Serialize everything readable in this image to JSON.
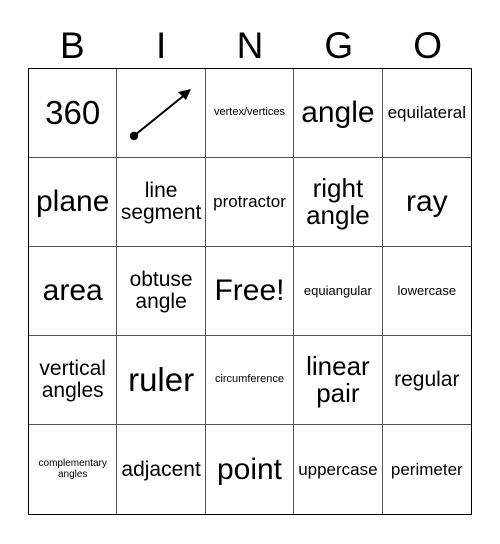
{
  "card": {
    "title_letters": [
      "B",
      "I",
      "N",
      "G",
      "O"
    ],
    "background_color": "#ffffff",
    "text_color": "#000000",
    "grid_border_color": "#000000",
    "cell_border_color": "#555555",
    "rows": 5,
    "columns": 5
  },
  "cells": [
    {
      "text": "360",
      "size": "fs-xxl",
      "type": "text"
    },
    {
      "text": "",
      "size": "fs-md",
      "type": "figure",
      "figure": "ray-diagram"
    },
    {
      "text": "vertex/vertices",
      "size": "fs-xxs",
      "type": "text"
    },
    {
      "text": "angle",
      "size": "fs-xl",
      "type": "text"
    },
    {
      "text": "equilateral",
      "size": "fs-sm",
      "type": "text"
    },
    {
      "text": "plane",
      "size": "fs-xl",
      "type": "text"
    },
    {
      "text": "line segment",
      "size": "fs-md",
      "type": "text"
    },
    {
      "text": "protractor",
      "size": "fs-sm",
      "type": "text"
    },
    {
      "text": "right angle",
      "size": "fs-lg",
      "type": "text"
    },
    {
      "text": "ray",
      "size": "fs-xl",
      "type": "text"
    },
    {
      "text": "area",
      "size": "fs-xl",
      "type": "text"
    },
    {
      "text": "obtuse angle",
      "size": "fs-md",
      "type": "text"
    },
    {
      "text": "Free!",
      "size": "fs-xl",
      "type": "text"
    },
    {
      "text": "equiangular",
      "size": "fs-xs",
      "type": "text"
    },
    {
      "text": "lowercase",
      "size": "fs-xs",
      "type": "text"
    },
    {
      "text": "vertical angles",
      "size": "fs-md",
      "type": "text"
    },
    {
      "text": "ruler",
      "size": "fs-xxl",
      "type": "text"
    },
    {
      "text": "circumference",
      "size": "fs-xxs",
      "type": "text"
    },
    {
      "text": "linear pair",
      "size": "fs-lg",
      "type": "text"
    },
    {
      "text": "regular",
      "size": "fs-md",
      "type": "text"
    },
    {
      "text": "complementary angles",
      "size": "fs-tiny",
      "type": "text"
    },
    {
      "text": "adjacent",
      "size": "fs-md",
      "type": "text"
    },
    {
      "text": "point",
      "size": "fs-xl",
      "type": "text"
    },
    {
      "text": "uppercase",
      "size": "fs-sm",
      "type": "text"
    },
    {
      "text": "perimeter",
      "size": "fs-sm",
      "type": "text"
    }
  ],
  "figure": {
    "ray_diagram": {
      "name": "ray-diagram",
      "description": "endpoint dot with arrow pointing up-right"
    }
  }
}
